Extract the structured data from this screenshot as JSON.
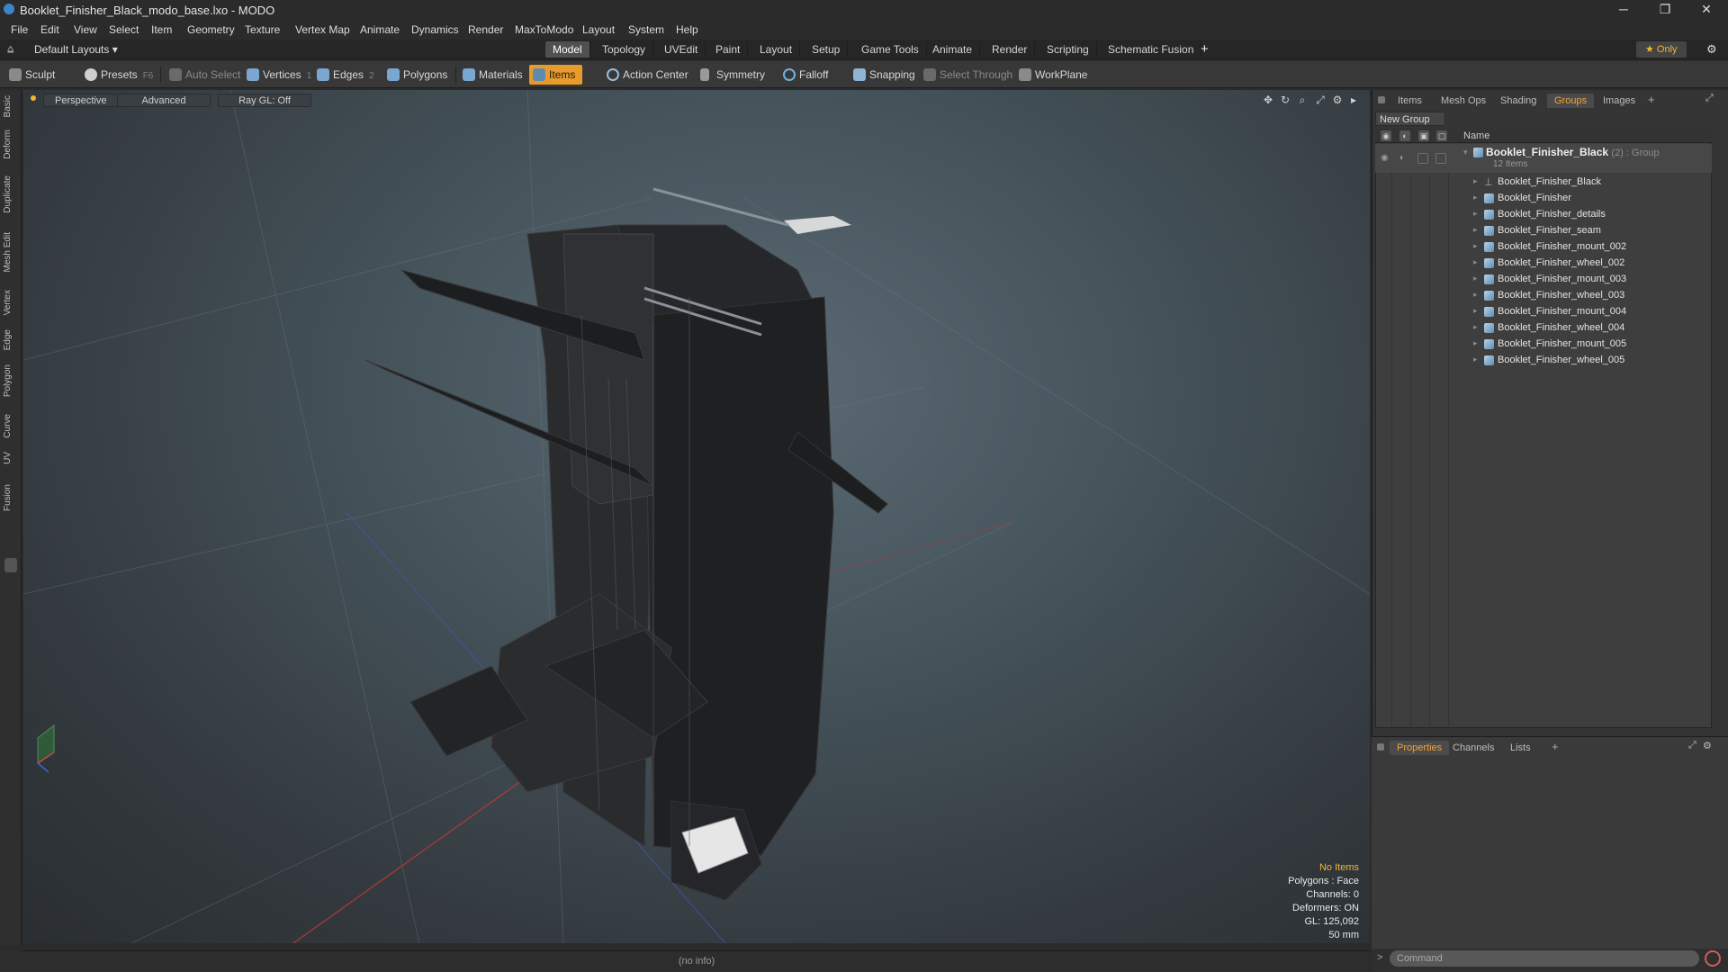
{
  "window": {
    "title": "Booklet_Finisher_Black_modo_base.lxo - MODO",
    "minimize": "─",
    "restore": "❐",
    "close": "✕"
  },
  "menu": [
    "File",
    "Edit",
    "View",
    "Select",
    "Item",
    "Geometry",
    "Texture",
    "Vertex Map",
    "Animate",
    "Dynamics",
    "Render",
    "MaxToModo",
    "Layout",
    "System",
    "Help"
  ],
  "layout_row": {
    "layouts_label": "Default Layouts ▾",
    "tabs": [
      "Model",
      "Topology",
      "UVEdit",
      "Paint",
      "Layout",
      "Setup",
      "Game Tools",
      "Animate",
      "Render",
      "Scripting",
      "Schematic Fusion"
    ],
    "active_tab": "Model",
    "add": "+",
    "only_label": "★  Only",
    "settings": "⚙"
  },
  "toolbar": {
    "sculpt": "Sculpt",
    "presets": "Presets",
    "presets_key": "F6",
    "auto_select": "Auto Select",
    "vertices": "Vertices",
    "vertices_key": "1",
    "edges": "Edges",
    "edges_key": "2",
    "polygons": "Polygons",
    "materials": "Materials",
    "items": "Items",
    "action_center": "Action Center",
    "symmetry": "Symmetry",
    "falloff": "Falloff",
    "snapping": "Snapping",
    "select_through": "Select Through",
    "workplane": "WorkPlane"
  },
  "left_tabs": [
    "Basic",
    "Deform",
    "Duplicate",
    "Mesh Edit",
    "Vertex",
    "Edge",
    "Polygon",
    "Curve",
    "UV",
    "Fusion"
  ],
  "viewport": {
    "view_mode": "Perspective",
    "shading": "Advanced",
    "raygl": "Ray GL: Off",
    "info": {
      "selection": "No Items",
      "polygons": "Polygons : Face",
      "channels": "Channels: 0",
      "deformers": "Deformers: ON",
      "gl": "GL: 125,092",
      "scale": "50 mm"
    }
  },
  "statusbar": {
    "info": "(no info)"
  },
  "right_panel": {
    "tabs": [
      "Items",
      "Mesh Ops",
      "Shading",
      "Groups",
      "Images"
    ],
    "active_tab": "Groups",
    "new_group": "New Group",
    "column_name": "Name",
    "group": {
      "name": "Booklet_Finisher_Black",
      "meta": "(2) : Group",
      "count": "12 Items"
    },
    "items": [
      "Booklet_Finisher_Black",
      "Booklet_Finisher",
      "Booklet_Finisher_details",
      "Booklet_Finisher_seam",
      "Booklet_Finisher_mount_002",
      "Booklet_Finisher_wheel_002",
      "Booklet_Finisher_mount_003",
      "Booklet_Finisher_wheel_003",
      "Booklet_Finisher_mount_004",
      "Booklet_Finisher_wheel_004",
      "Booklet_Finisher_mount_005",
      "Booklet_Finisher_wheel_005"
    ],
    "bottom_tabs": [
      "Properties",
      "Channels",
      "Lists"
    ],
    "bottom_active": "Properties",
    "command_placeholder": "Command"
  }
}
